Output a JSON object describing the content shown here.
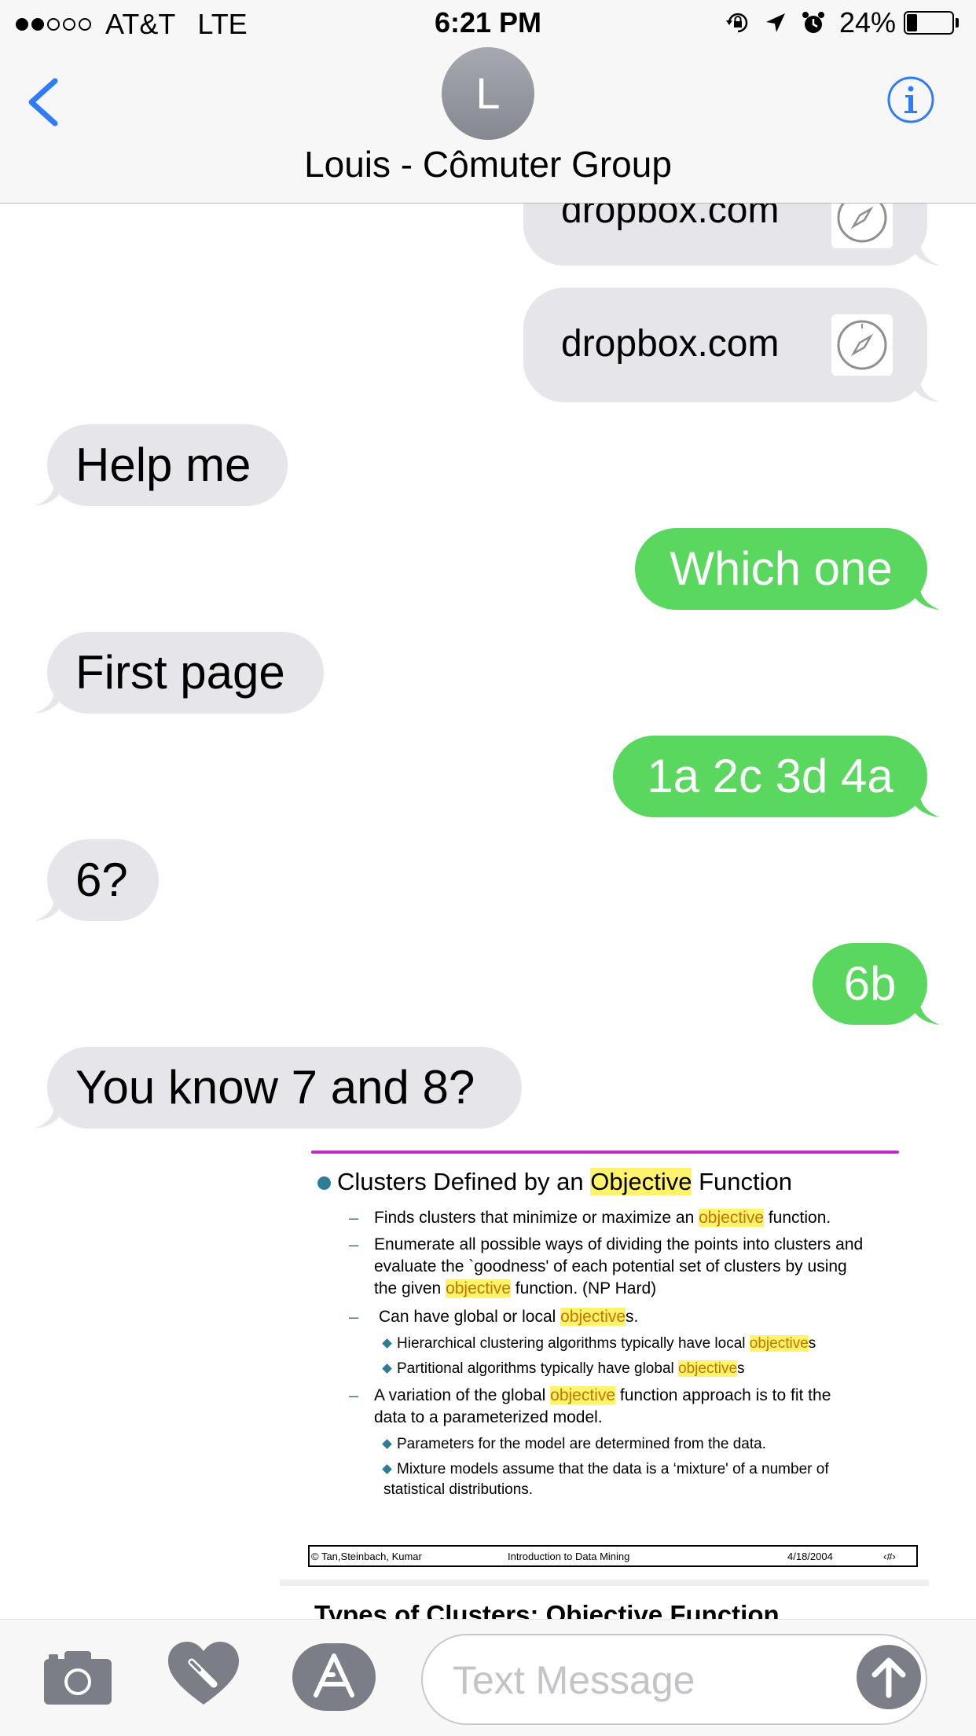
{
  "status_bar": {
    "carrier": "AT&T",
    "network": "LTE",
    "time": "6:21 PM",
    "battery": "24%",
    "battery_level": 0.24,
    "signal_bars": 2,
    "signal_total": 5
  },
  "header": {
    "avatar_initial": "L",
    "contact_name": "Louis - Cômuter Group"
  },
  "messages": [
    {
      "from": "me",
      "type": "link",
      "text": "dropbox.com"
    },
    {
      "from": "me",
      "type": "link",
      "text": "dropbox.com"
    },
    {
      "from": "them",
      "text": "Help me"
    },
    {
      "from": "me",
      "text": "Which one"
    },
    {
      "from": "them",
      "text": "First page"
    },
    {
      "from": "me",
      "text": "1a 2c 3d 4a"
    },
    {
      "from": "them",
      "text": "6?"
    },
    {
      "from": "me",
      "text": "6b"
    },
    {
      "from": "them",
      "text": "You know 7 and 8?"
    }
  ],
  "slide": {
    "heading_pre": "Clusters Defined by an ",
    "heading_hl": "Objective",
    "heading_post": " Function",
    "l1a": "Finds clusters that minimize or maximize an ",
    "l1hl": "objective",
    "l1b": " function.",
    "l2a": "Enumerate all possible ways of dividing the points into clusters and",
    "l2b": "evaluate the `goodness' of each potential set of clusters by using",
    "l2c": "the given ",
    "l2hl": "objective",
    "l2d": " function.  (NP Hard)",
    "l3a": "Can have global or local ",
    "l3hl": "objective",
    "l3b": "s.",
    "l4a": "Hierarchical clustering algorithms typically have local ",
    "l4hl": "objective",
    "l4b": "s",
    "l5a": "Partitional algorithms typically have global ",
    "l5hl": "objective",
    "l5b": "s",
    "l6a": "A variation of the global ",
    "l6hl": "objective",
    "l6b": " function approach is to fit the",
    "l6c": "data to a parameterized model.",
    "l7": "Parameters for the model are determined from the data.",
    "l8a": "Mixture models assume that the data is a ‘mixture' of a number of",
    "l8b": "statistical distributions.",
    "footer_left": "© Tan,Steinbach, Kumar",
    "footer_center": "Introduction to Data Mining",
    "footer_date": "4/18/2004",
    "footer_page": "‹#›",
    "next_title": "Types of Clusters: Objective Function ..."
  },
  "input_bar": {
    "placeholder": "Text Message"
  },
  "colors": {
    "outgoing": "#5ad75f",
    "incoming": "#e5e5ea",
    "accent": "#2f7cf6"
  }
}
